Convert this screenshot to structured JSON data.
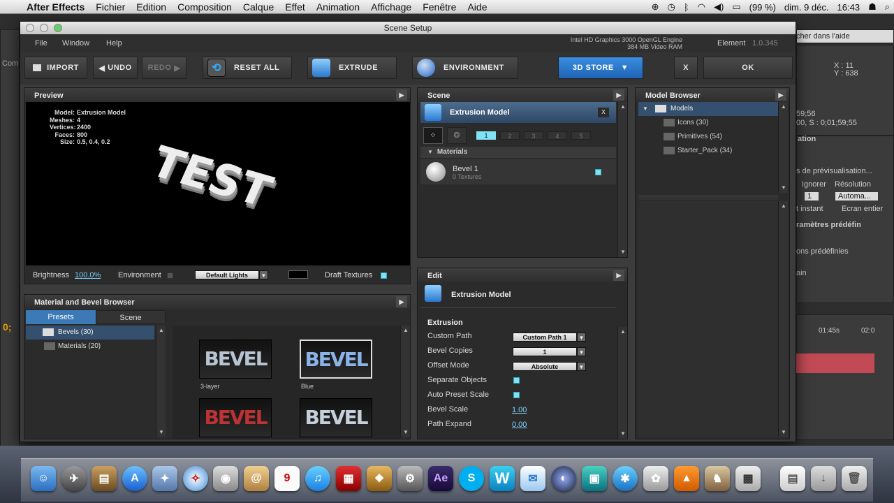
{
  "menubar": {
    "app": "After Effects",
    "items": [
      "Fichier",
      "Edition",
      "Composition",
      "Calque",
      "Effet",
      "Animation",
      "Affichage",
      "Fenêtre",
      "Aide"
    ],
    "date": "dim. 9 déc.",
    "time": "16:43",
    "battery": "(99 %)"
  },
  "ae_bg": {
    "search": "cher dans l'aide",
    "coords_x": "X : 11",
    "coords_y": "Y : 638",
    "tc1": "59;56",
    "tc2": "00, S : 0;01;59;55",
    "panel_title": "ation",
    "preview_menu": "s de prévisualisation...",
    "ignorer": "Ignorer",
    "resolution": "Résolution",
    "res_val": "Automa...",
    "ign_val": "1",
    "instant": "t instant",
    "ecran": "Ecran entier",
    "params": "ramètres prédéfin",
    "predef": "ons prédéfinies",
    "ain": "ain",
    "time_ruler": "01:45s",
    "time_ruler2": "02:0",
    "comp_label": "Com"
  },
  "dialog": {
    "title": "Scene Setup",
    "menu": [
      "File",
      "Window",
      "Help"
    ],
    "gpu_line1": "Intel HD Graphics 3000 OpenGL Engine",
    "gpu_line2": "384 MB Video RAM",
    "element_label": "Element",
    "element_version": "1.0.345",
    "toolbar": {
      "import": "IMPORT",
      "undo": "UNDO",
      "redo": "REDO",
      "reset": "RESET ALL",
      "extrude": "EXTRUDE",
      "environment": "ENVIRONMENT",
      "store": "3D STORE",
      "close": "X",
      "ok": "OK"
    },
    "preview": {
      "title": "Preview",
      "model_label": "Model:",
      "model": "Extrusion Model",
      "meshes_label": "Meshes:",
      "meshes": "4",
      "vertices_label": "Vertices:",
      "vertices": "2400",
      "faces_label": "Faces:",
      "faces": "800",
      "size_label": "Size:",
      "size": "0.5, 0.4, 0.2",
      "render_text": "TEST",
      "brightness_label": "Brightness",
      "brightness": "100.0%",
      "environment_label": "Environment",
      "lights": "Default Lights",
      "draft_label": "Draft Textures"
    },
    "scene": {
      "title": "Scene",
      "model": "Extrusion Model",
      "close": "x",
      "tabs": [
        "1",
        "2",
        "3",
        "4",
        "5"
      ],
      "materials_header": "Materials",
      "material_name": "Bevel 1",
      "material_sub": "0 Textures"
    },
    "model_browser": {
      "title": "Model Browser",
      "root": "Models",
      "items": [
        "Icons (30)",
        "Primitives (54)",
        "Starter_Pack (34)"
      ]
    },
    "edit": {
      "title": "Edit",
      "model": "Extrusion Model",
      "section": "Extrusion",
      "rows": [
        {
          "label": "Custom Path",
          "value": "Custom Path 1"
        },
        {
          "label": "Bevel Copies",
          "value": "1"
        },
        {
          "label": "Offset Mode",
          "value": "Absolute"
        },
        {
          "label": "Separate Objects",
          "value": ""
        },
        {
          "label": "Auto Preset Scale",
          "value": ""
        },
        {
          "label": "Bevel Scale",
          "value": "1.00"
        },
        {
          "label": "Path Expand",
          "value": "0.00"
        }
      ]
    },
    "material_browser": {
      "title": "Material and Bevel Browser",
      "tabs": [
        "Presets",
        "Scene"
      ],
      "tree": [
        "Bevels (30)",
        "Materials (20)"
      ],
      "thumb_text": "BEVEL",
      "thumbs": [
        "3-layer",
        "Blue",
        "",
        ""
      ]
    }
  },
  "colors": {
    "accent_cyan": "#7fe3f5",
    "store_blue": "#2a78cf",
    "selected_row": "#34506e"
  }
}
